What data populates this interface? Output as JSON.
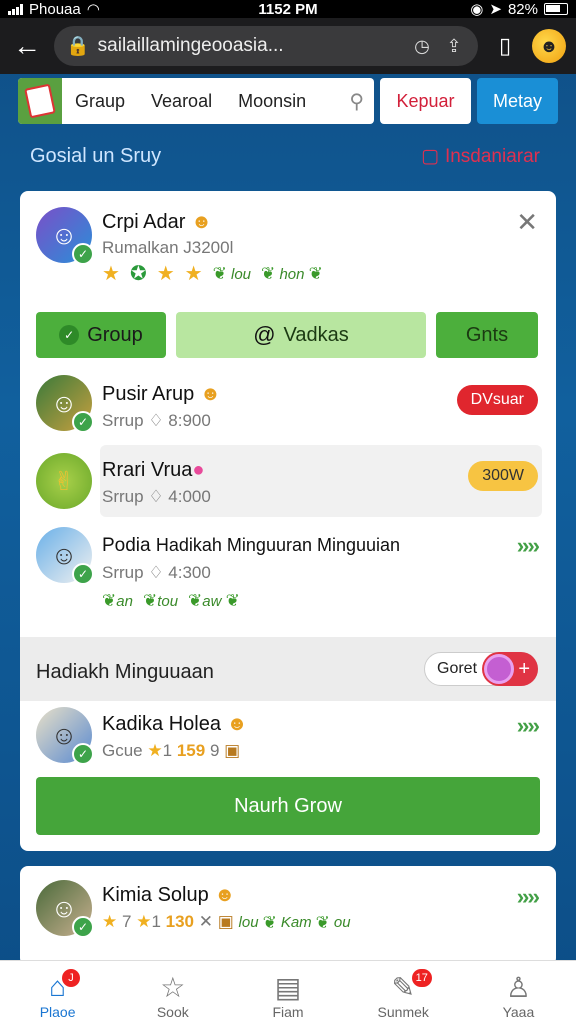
{
  "status": {
    "carrier": "Phouaa",
    "time": "1152 PM",
    "battery": "82%"
  },
  "browser": {
    "url": "sailaillamingeooasia..."
  },
  "nav": {
    "tabs": [
      "Graup",
      "Vearoal",
      "Moonsin"
    ],
    "kepuar": "Kepuar",
    "metay": "Metay"
  },
  "section": {
    "title": "Gosial un Sruy",
    "action": "Insdaniarar"
  },
  "profile": {
    "name": "Crpi Adar",
    "subtitle": "Rumalkan J3200l",
    "tags": [
      "lou",
      "hon"
    ]
  },
  "tabs": {
    "group": "Group",
    "vadkas": "Vadkas",
    "gnts": "Gnts"
  },
  "rows": [
    {
      "name": "Pusir Arup",
      "sub": "Srrup",
      "count": "8:900",
      "pill": "DVsuar"
    },
    {
      "name": "Rrari Vrua",
      "sub": "Srrup",
      "count": "4:000",
      "pill": "300W"
    },
    {
      "name": "Podia",
      "name_rest": "Hadikah Minguuran Minguuian",
      "sub": "Srrup",
      "count": "4:300",
      "tags": [
        "an",
        "tou",
        "aw"
      ]
    }
  ],
  "band": {
    "title": "Hadiakh Minguuaan",
    "toggle_label": "Goret"
  },
  "featured": {
    "name": "Kadika Holea",
    "sub": "Gcue",
    "rating": "1",
    "score": "159",
    "extra": "9"
  },
  "big_button": "Naurh Grow",
  "card2": {
    "name": "Kimia Solup",
    "rating1": "7",
    "rating2": "1",
    "score": "130",
    "tags": [
      "lou",
      "Kam",
      "ou"
    ]
  },
  "bottom": {
    "items": [
      {
        "label": "Plaoe",
        "badge": "J"
      },
      {
        "label": "Sook"
      },
      {
        "label": "Fiam"
      },
      {
        "label": "Sunmek",
        "badge": "17"
      },
      {
        "label": "Yaaa"
      }
    ]
  },
  "colors": {
    "accent_green": "#45a53a",
    "brand_blue": "#1a8fd6",
    "alert_red": "#e0262e"
  }
}
